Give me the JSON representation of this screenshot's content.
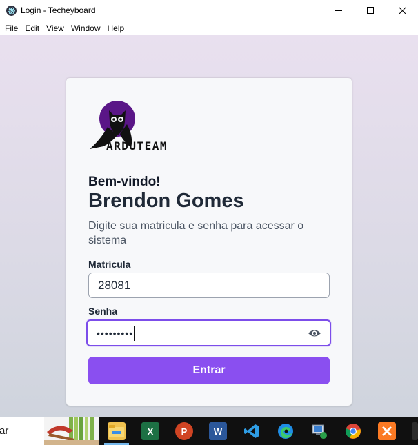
{
  "window": {
    "title": "Login - Techeyboard",
    "icon": "electron-icon",
    "controls": [
      "minimize-icon",
      "maximize-icon",
      "close-icon"
    ]
  },
  "menu": [
    "File",
    "Edit",
    "View",
    "Window",
    "Help"
  ],
  "login": {
    "logo_text": "ARDUTEAM",
    "welcome": "Bem-vindo!",
    "user_name": "Brendon Gomes",
    "subtitle": "Digite sua matricula e senha para acessar o sistema",
    "matricula_label": "Matrícula",
    "matricula_value": "28081",
    "senha_label": "Senha",
    "senha_value": "•••••••••",
    "show_password_icon": "eye-icon",
    "submit_label": "Entrar"
  },
  "taskbar": {
    "search_text": "ar",
    "apps": [
      "file-explorer-icon",
      "excel-icon",
      "powerpoint-icon",
      "word-icon",
      "vscode-icon",
      "edge-icon",
      "network-icon",
      "chrome-icon",
      "xampp-icon"
    ]
  },
  "colors": {
    "accent": "#8a4ff0",
    "focus_border": "#7c4dea",
    "logo_circle": "#5a1687"
  }
}
